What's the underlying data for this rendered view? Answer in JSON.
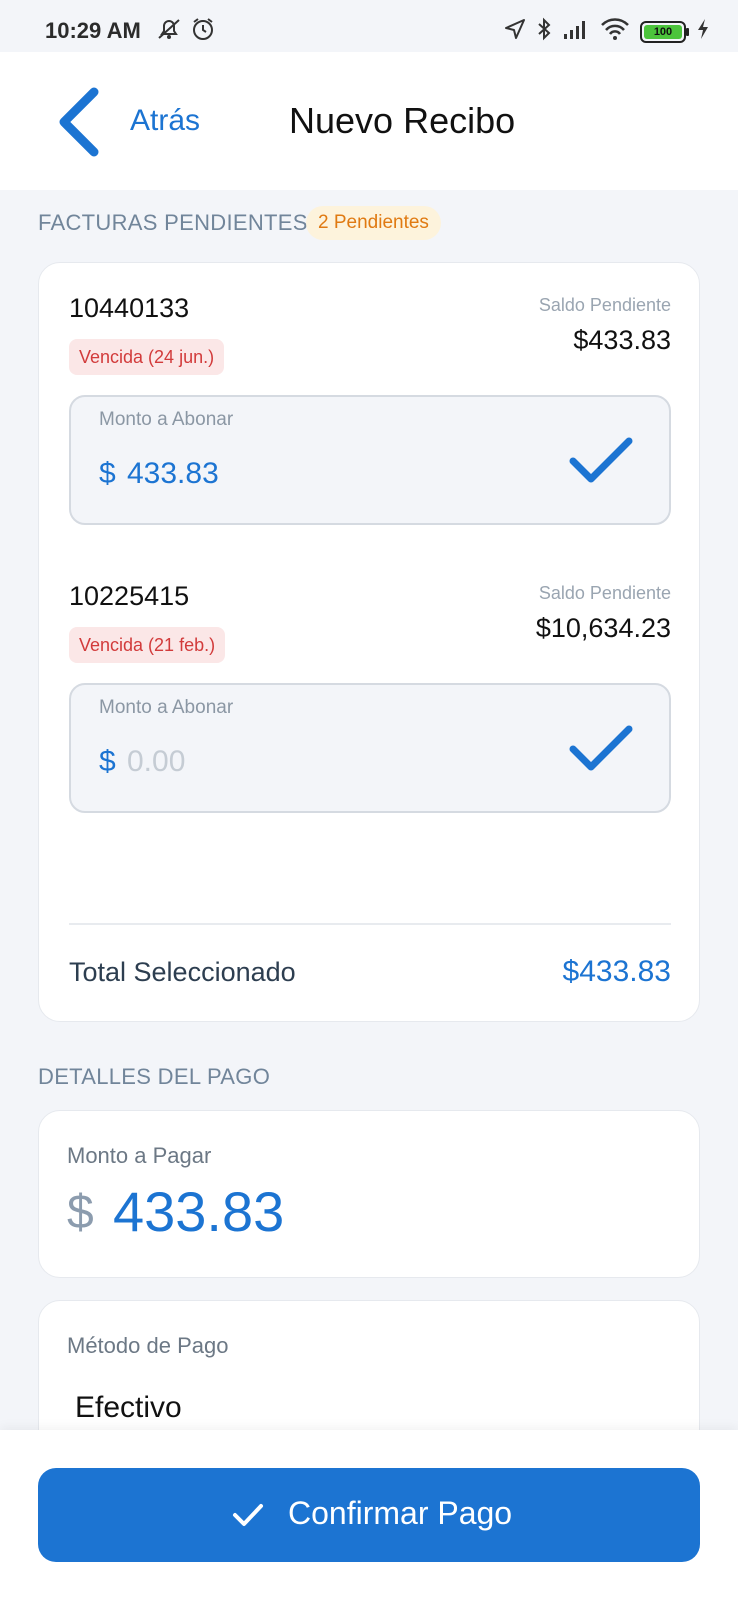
{
  "status_bar": {
    "time": "10:29 AM",
    "battery": "100",
    "icons": [
      "notifications-off-icon",
      "alarm-icon",
      "location-arrow-icon",
      "bluetooth-icon",
      "signal-icon",
      "wifi-icon",
      "battery-icon",
      "charging-icon"
    ]
  },
  "header": {
    "back_label": "Atrás",
    "title": "Nuevo Recibo"
  },
  "pending_section": {
    "label": "FACTURAS PENDIENTES",
    "badge": "2 Pendientes",
    "invoices": [
      {
        "number": "10440133",
        "status": "Vencida (24 jun.)",
        "balance_label": "Saldo Pendiente",
        "balance": "$433.83",
        "amount_label": "Monto a Abonar",
        "currency": "$",
        "amount": "433.83"
      },
      {
        "number": "10225415",
        "status": "Vencida (21 feb.)",
        "balance_label": "Saldo Pendiente",
        "balance": "$10,634.23",
        "amount_label": "Monto a Abonar",
        "currency": "$",
        "amount_placeholder": "0.00"
      }
    ],
    "total_label": "Total Seleccionado",
    "total_value": "$433.83"
  },
  "payment_section": {
    "label": "DETALLES DEL PAGO",
    "amount_label": "Monto a Pagar",
    "currency": "$",
    "amount": "433.83",
    "method_label": "Método de Pago",
    "method_value": "Efectivo"
  },
  "confirm_button": {
    "label": "Confirmar Pago"
  },
  "colors": {
    "accent": "#1c74d2",
    "background": "#f3f5f9",
    "overdue": "#d23b3b",
    "pending_badge": "#e07a12"
  }
}
